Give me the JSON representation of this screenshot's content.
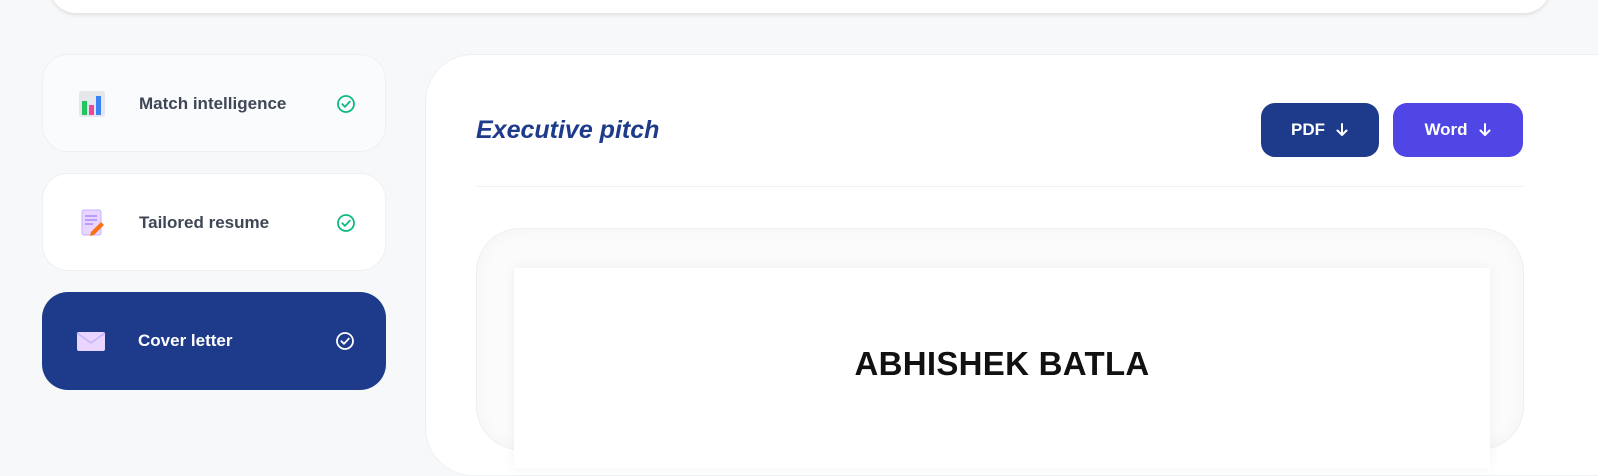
{
  "sidebar": {
    "items": [
      {
        "label": "Match intelligence",
        "icon": "bar-chart-icon",
        "status": "complete",
        "active": false
      },
      {
        "label": "Tailored resume",
        "icon": "document-edit-icon",
        "status": "complete",
        "active": false
      },
      {
        "label": "Cover letter",
        "icon": "envelope-icon",
        "status": "complete",
        "active": true
      }
    ]
  },
  "main": {
    "title": "Executive pitch",
    "buttons": {
      "pdf_label": "PDF",
      "word_label": "Word"
    },
    "document": {
      "name": "ABHISHEK BATLA"
    }
  },
  "colors": {
    "primary": "#1e3a8a",
    "accent": "#4f46e5",
    "success": "#10b981",
    "background": "#f7f8fa"
  }
}
